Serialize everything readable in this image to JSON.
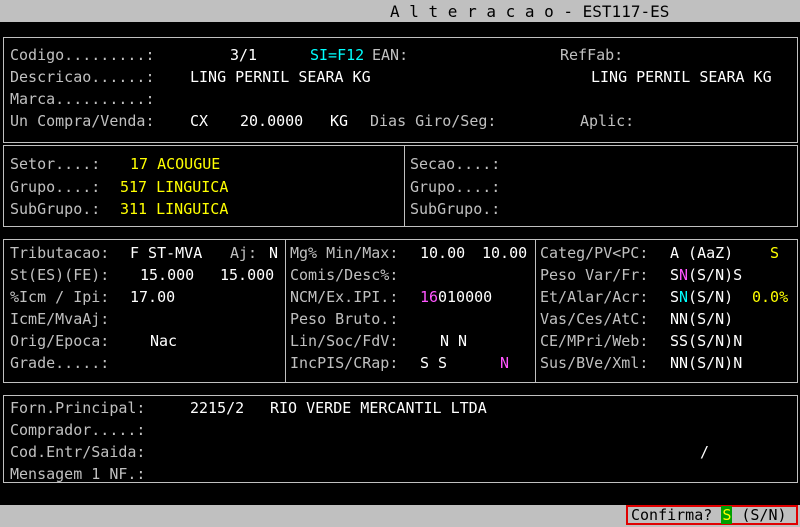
{
  "window": {
    "title": "A l t e r a c a o - EST117-ES"
  },
  "product": {
    "codigo_label": "Codigo.........:",
    "codigo": "3/1",
    "si_hint": "SI=F12",
    "ean_label": "EAN:",
    "reffab_label": "RefFab:",
    "descricao_label": "Descricao......:",
    "descricao": "LING PERNIL SEARA KG",
    "descricao2": "LING PERNIL SEARA KG",
    "marca_label": "Marca..........:",
    "uncompra_label": "Un Compra/Venda:",
    "un_compra": "CX",
    "fator": "20.0000",
    "un_venda": "KG",
    "diasgiro_label": "Dias Giro/Seg:",
    "aplic_label": "Aplic:"
  },
  "classification": {
    "setor_label": "Setor....:",
    "setor": "17 ACOUGUE",
    "grupo_label": "Grupo....:",
    "grupo": "517 LINGUICA",
    "subgrupo_label": "SubGrupo.:",
    "subgrupo": "311 LINGUICA",
    "secao_label": "Secao....:",
    "grupo2_label": "Grupo....:",
    "subgrupo2_label": "SubGrupo.:"
  },
  "fiscal": {
    "tributacao_label": "Tributacao:",
    "tributacao": "F ST-MVA",
    "aj_label": "Aj:",
    "aj": "N",
    "st_label": "St(ES)(FE):",
    "st_es": "15.000",
    "st_fe": "15.000",
    "icm_label": "%Icm / Ipi:",
    "icm": "17.00",
    "icme_label": "IcmE/MvaAj:",
    "orig_label": "Orig/Epoca:",
    "orig": "Nac",
    "grade_label": "Grade.....:"
  },
  "margins": {
    "mg_label": "Mg% Min/Max:",
    "mg_min": "10.00",
    "mg_max": "10.00",
    "comis_label": "Comis/Desc%:",
    "ncm_label": "NCM/Ex.IPI.:",
    "ncm_a": "16",
    "ncm_b": "010000",
    "peso_label": "Peso Bruto.:",
    "lin_label": "Lin/Soc/FdV:",
    "lin": "N N",
    "inc_label": "IncPIS/CRap:",
    "inc": "S S",
    "inc2": "N"
  },
  "flags": {
    "categ_label": "Categ/PV<PC:",
    "categ": "A (AaZ)",
    "categ_s": "S",
    "pesovar_label": "Peso Var/Fr:",
    "pesovar_a": "S",
    "pesovar_b": "N",
    "pesovar_c": "(S/N)S",
    "etalar_label": "Et/Alar/Acr:",
    "etalar_a": "S",
    "etalar_b": "N",
    "etalar_c": "(S/N)",
    "etalar_pct": "0.0%",
    "vas_label": "Vas/Ces/AtC:",
    "vas": "NN(S/N)",
    "ce_label": "CE/MPri/Web:",
    "ce": "SS(S/N)N",
    "sus_label": "Sus/BVe/Xml:",
    "sus": "NN(S/N)N"
  },
  "supplier": {
    "forn_label": "Forn.Principal:",
    "forn_code": "2215/2",
    "forn_name": "RIO VERDE MERCANTIL LTDA",
    "comprador_label": "Comprador.....:",
    "codentr_label": "Cod.Entr/Saida:",
    "codentr_slash": "/",
    "mensagem_label": "Mensagem 1 NF.:"
  },
  "status": {
    "confirm_label": "Confirma?",
    "confirm_value": "S",
    "confirm_options": "(S/N)"
  }
}
